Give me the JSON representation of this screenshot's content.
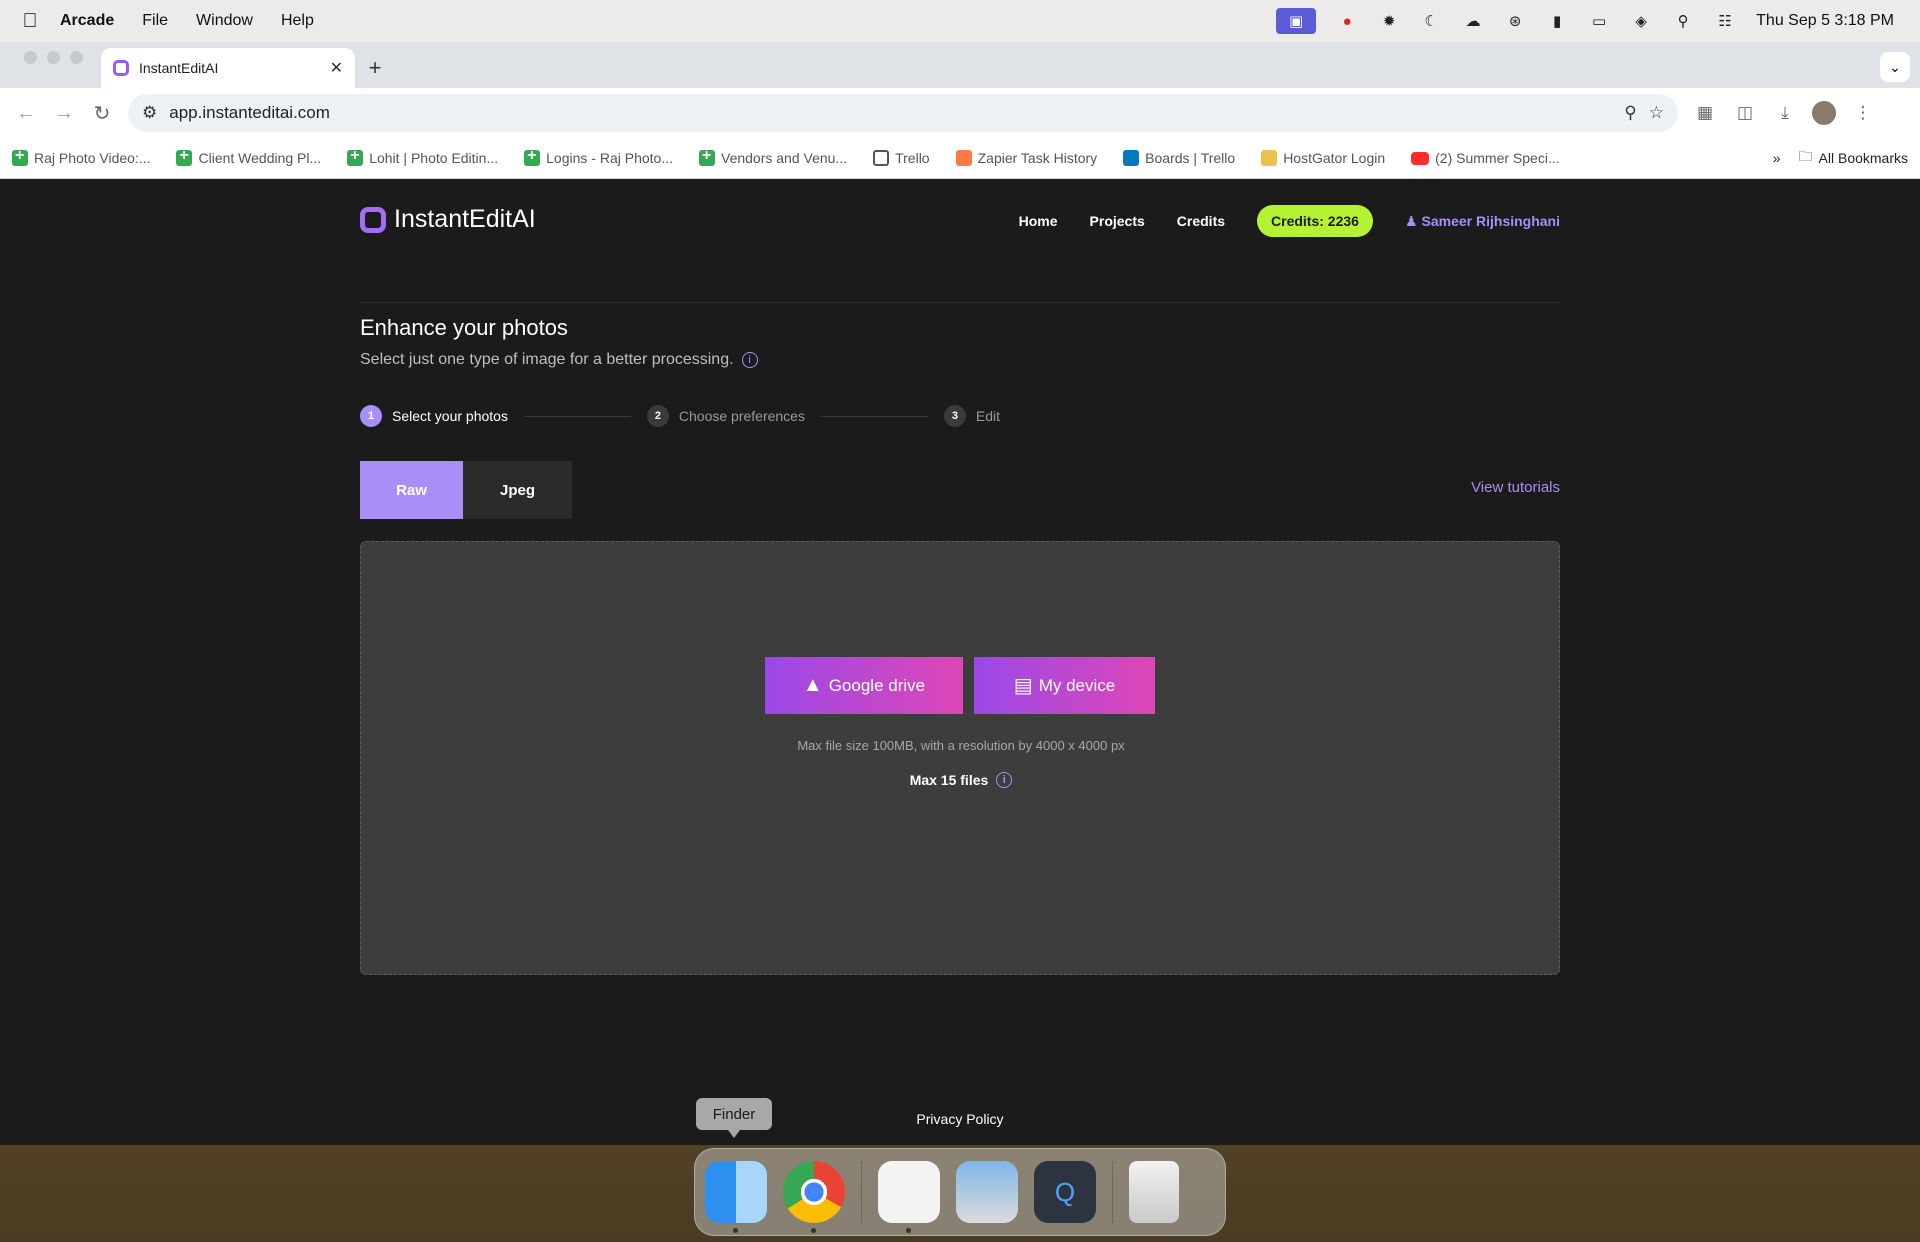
{
  "menubar": {
    "app_name": "Arcade",
    "items": [
      "File",
      "Window",
      "Help"
    ],
    "clock": "Thu Sep 5  3:18 PM"
  },
  "browser": {
    "tab_title": "InstantEditAI",
    "url": "app.instanteditai.com",
    "bookmarks": [
      "Raj Photo Video:...",
      "Client Wedding Pl...",
      "Lohit | Photo Editin...",
      "Logins - Raj Photo...",
      "Vendors and Venu...",
      "Trello",
      "Zapier Task History",
      "Boards | Trello",
      "HostGator Login",
      "(2) Summer Speci..."
    ],
    "all_bookmarks": "All Bookmarks"
  },
  "app": {
    "brand": "InstantEditAI",
    "nav": {
      "home": "Home",
      "projects": "Projects",
      "credits": "Credits",
      "credits_badge": "Credits: 2236",
      "user": "Sameer Rijhsinghani"
    },
    "title": "Enhance your photos",
    "subtitle": "Select just one type of image for a better processing.",
    "steps": [
      {
        "num": "1",
        "label": "Select your photos"
      },
      {
        "num": "2",
        "label": "Choose preferences"
      },
      {
        "num": "3",
        "label": "Edit"
      }
    ],
    "type_tabs": {
      "raw": "Raw",
      "jpeg": "Jpeg"
    },
    "view_tutorials": "View tutorials",
    "upload": {
      "google_drive": "Google drive",
      "my_device": "My device",
      "hint": "Max file size 100MB, with a resolution by 4000 x 4000 px",
      "max_files": "Max 15 files"
    },
    "privacy": "Privacy Policy"
  },
  "dock": {
    "tooltip": "Finder"
  }
}
